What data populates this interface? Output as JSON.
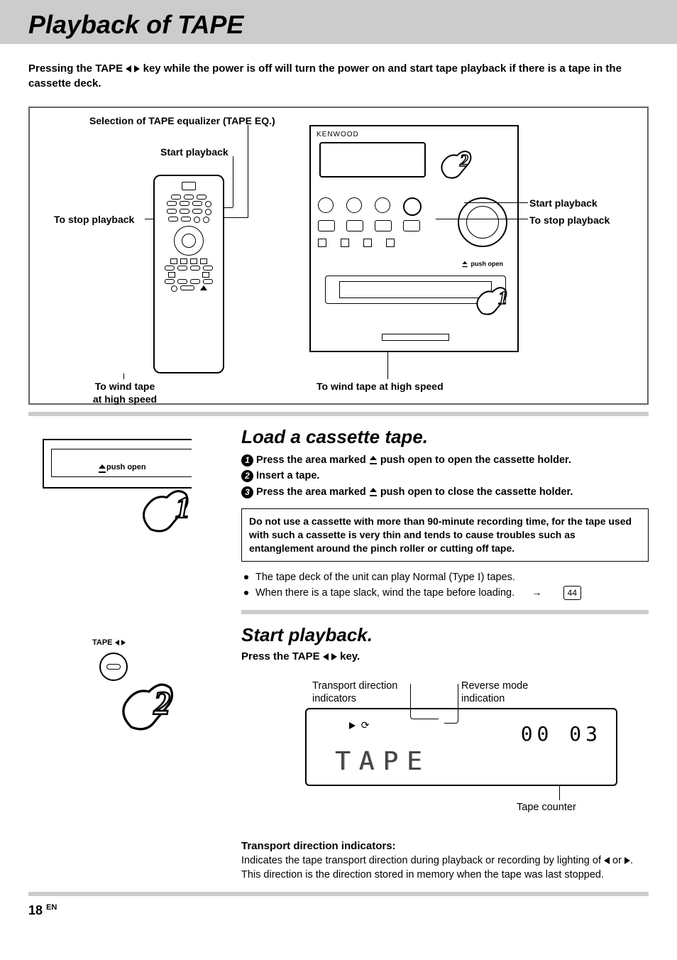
{
  "page": {
    "title": "Playback of TAPE",
    "intro_a": "Pressing the TAPE ",
    "intro_b": " key while the power is off will turn the power on and start tape playback if there is a tape in the cassette deck.",
    "number": "18",
    "lang": "EN"
  },
  "diagram": {
    "eq_label": "Selection of TAPE equalizer (TAPE EQ.)",
    "start_playback": "Start playback",
    "stop_playback": "To stop playback",
    "wind_tape": "To wind tape at  high speed",
    "wind_tape_left_a": "To wind tape",
    "wind_tape_left_b": "at  high speed",
    "unit_brand": "KENWOOD",
    "push_open": "push open"
  },
  "step1": {
    "heading": "Load a cassette tape.",
    "s1a": "Press the area marked ",
    "s1b": " push open  to open the cassette holder.",
    "s2": "Insert a tape.",
    "s3a": "Press the area marked ",
    "s3b": " push open to close the cassette holder.",
    "warn": "Do not use a cassette with more than 90-minute recording time, for the tape used with such a cassette is very thin and tends to cause troubles such as entanglement around the pinch roller or cutting off tape.",
    "b1a": "The tape deck of the unit can play Normal (Type ",
    "b1_type": "I",
    "b1b": ")  tapes.",
    "b2": "When there is a tape slack, wind the tape before loading.",
    "ref": "44",
    "push_open": "push open"
  },
  "step2": {
    "heading": "Start playback.",
    "press": "Press the TAPE ",
    "press_b": " key.",
    "tape_label": "TAPE",
    "callout_transport_a": "Transport direction",
    "callout_transport_b": "indicators",
    "callout_rev_a": "Reverse mode",
    "callout_rev_b": "indication",
    "callout_counter": "Tape counter",
    "lcd_tape": "TAPE",
    "lcd_counter": "00 03",
    "footer_h": "Transport direction indicators:",
    "footer_p_a": "Indicates the tape transport direction during playback or recording by lighting of ",
    "footer_p_b": " or ",
    "footer_p_c": ". This direction is the direction stored in memory when the tape was last stopped."
  }
}
